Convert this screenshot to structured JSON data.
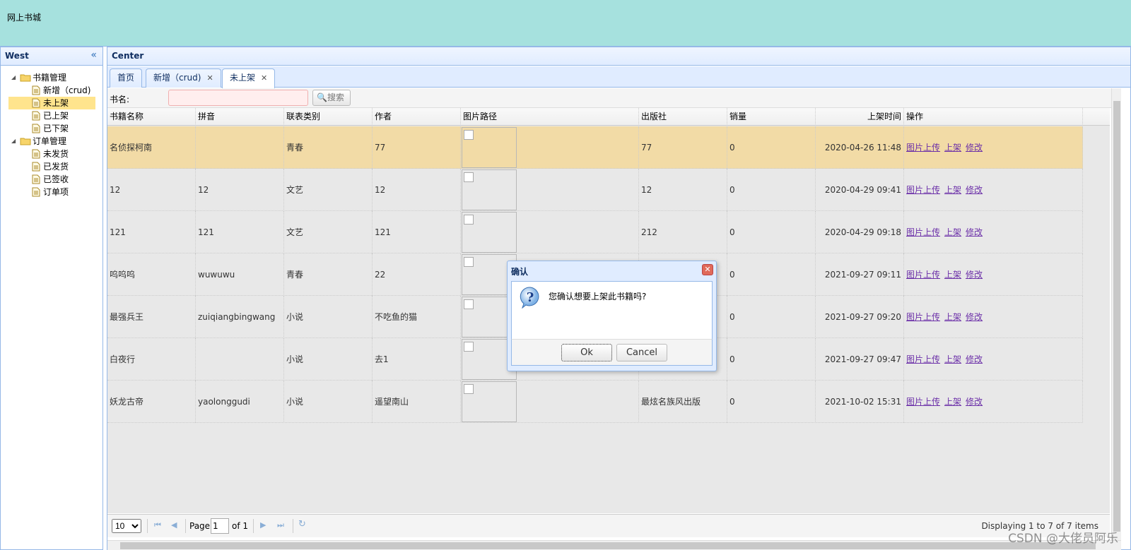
{
  "app": {
    "title": "网上书城"
  },
  "west": {
    "title": "West",
    "tree": [
      {
        "label": "书籍管理",
        "children": [
          "新增（crud)",
          "未上架",
          "已上架",
          "已下架"
        ]
      },
      {
        "label": "订单管理",
        "children": [
          "未发货",
          "已发货",
          "已签收",
          "订单项"
        ]
      }
    ],
    "selected": "未上架"
  },
  "center": {
    "title": "Center",
    "tabs": [
      {
        "label": "首页"
      },
      {
        "label": "新增（crud)"
      },
      {
        "label": "未上架"
      }
    ]
  },
  "search": {
    "label": "书名:",
    "value": "",
    "button": "搜索"
  },
  "grid": {
    "columns": [
      "书籍名称",
      "拼音",
      "联表类别",
      "作者",
      "图片路径",
      "出版社",
      "销量",
      "上架时间",
      "操作"
    ],
    "rows": [
      {
        "name": "名侦探柯南",
        "pinyin": "",
        "category": "青春",
        "author": "77",
        "publisher": "77",
        "sales": "0",
        "time": "2020-04-26 11:48"
      },
      {
        "name": "12",
        "pinyin": "12",
        "category": "文艺",
        "author": "12",
        "publisher": "12",
        "sales": "0",
        "time": "2020-04-29 09:41"
      },
      {
        "name": "121",
        "pinyin": "121",
        "category": "文艺",
        "author": "121",
        "publisher": "212",
        "sales": "0",
        "time": "2020-04-29 09:18"
      },
      {
        "name": "呜呜呜",
        "pinyin": "wuwuwu",
        "category": "青春",
        "author": "22",
        "publisher": "",
        "sales": "0",
        "time": "2021-09-27 09:11"
      },
      {
        "name": "最强兵王",
        "pinyin": "zuiqiangbingwang",
        "category": "小说",
        "author": "不吃鱼的猫",
        "publisher": "",
        "sales": "0",
        "time": "2021-09-27 09:20"
      },
      {
        "name": "白夜行",
        "pinyin": "",
        "category": "小说",
        "author": "去1",
        "publisher": "",
        "sales": "0",
        "time": "2021-09-27 09:47"
      },
      {
        "name": "妖龙古帝",
        "pinyin": "yaolonggudi",
        "category": "小说",
        "author": "遥望南山",
        "publisher": "最炫名族风出版",
        "sales": "0",
        "time": "2021-10-02 15:31"
      }
    ],
    "actions": [
      "图片上传",
      "上架",
      "修改"
    ]
  },
  "pager": {
    "page_size": "10",
    "page_label": "Page",
    "page": "1",
    "of_label": "of 1",
    "display": "Displaying 1 to 7 of 7 items"
  },
  "dialog": {
    "title": "确认",
    "message": "您确认想要上架此书籍吗?",
    "ok": "Ok",
    "cancel": "Cancel"
  },
  "watermark": "CSDN @大佬员阿乐",
  "colors": {
    "header_bg": "#a6e1de",
    "panel_border": "#95b8e7",
    "row_highlight": "#f2dba6",
    "selected_tree": "#ffe48d",
    "link": "#6b2fa8"
  }
}
